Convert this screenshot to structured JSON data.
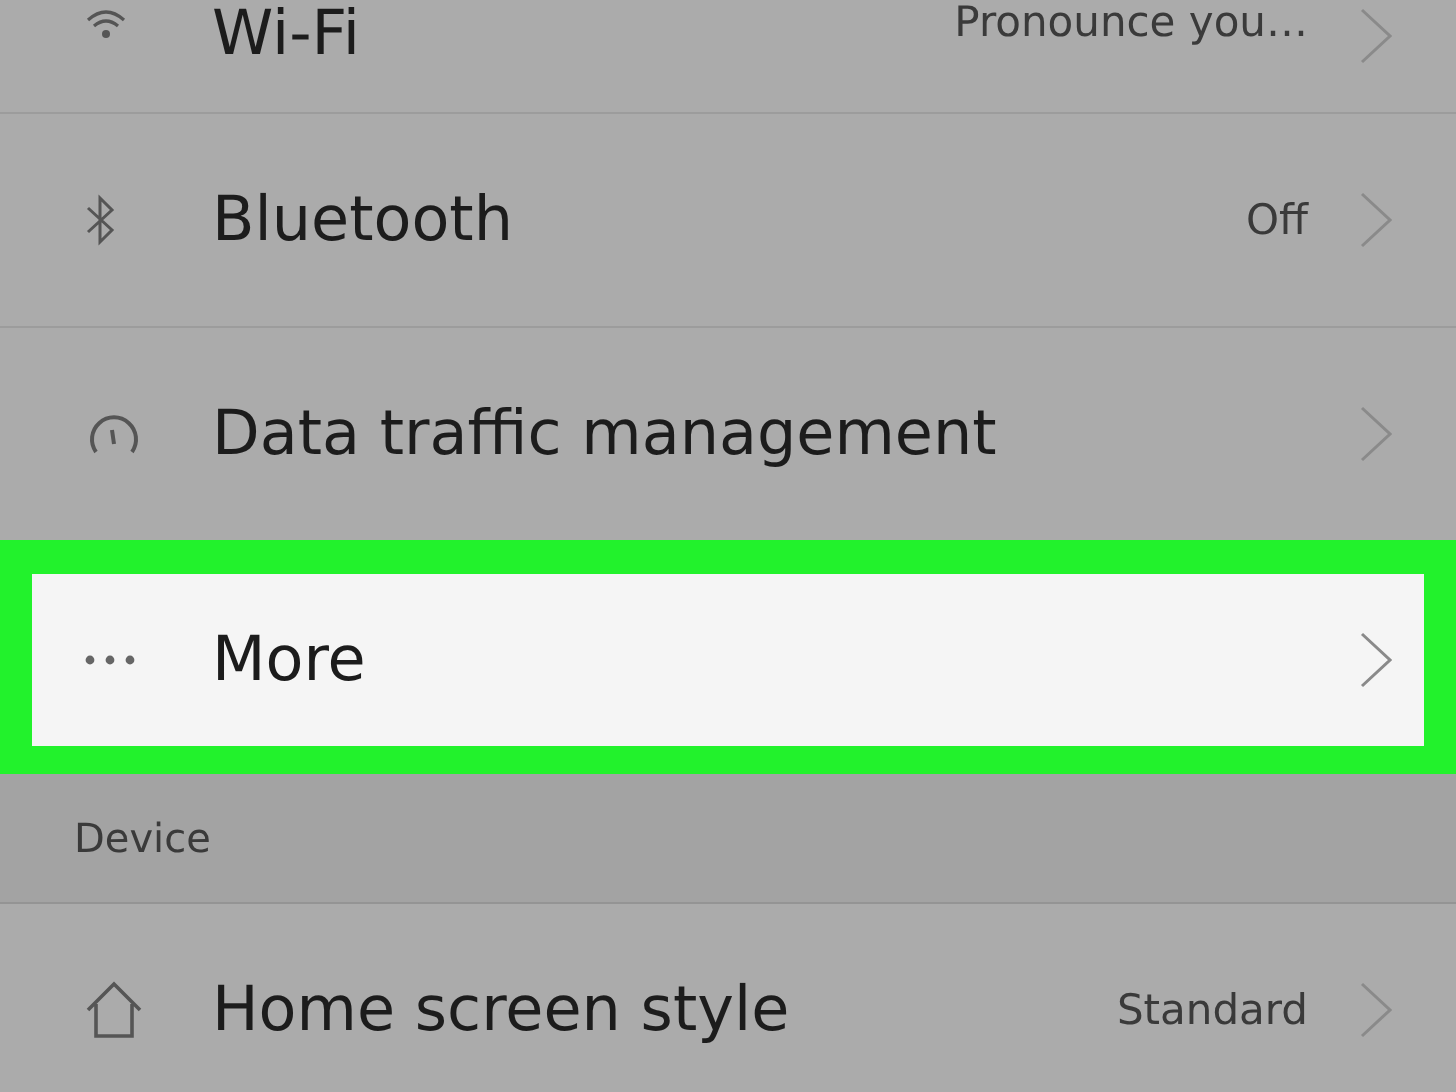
{
  "items": [
    {
      "kind": "row",
      "title": "Wi-Fi",
      "value": "Pronounce you…",
      "selected": false
    },
    {
      "kind": "row",
      "title": "Bluetooth",
      "value": "Off",
      "selected": false
    },
    {
      "kind": "row",
      "title": "Data traffic management",
      "selected": false
    },
    {
      "kind": "row",
      "title": "More",
      "selected": true
    },
    {
      "kind": "header",
      "title": "Device"
    },
    {
      "kind": "row",
      "title": "Home screen style",
      "value": "Standard",
      "selected": false
    }
  ]
}
